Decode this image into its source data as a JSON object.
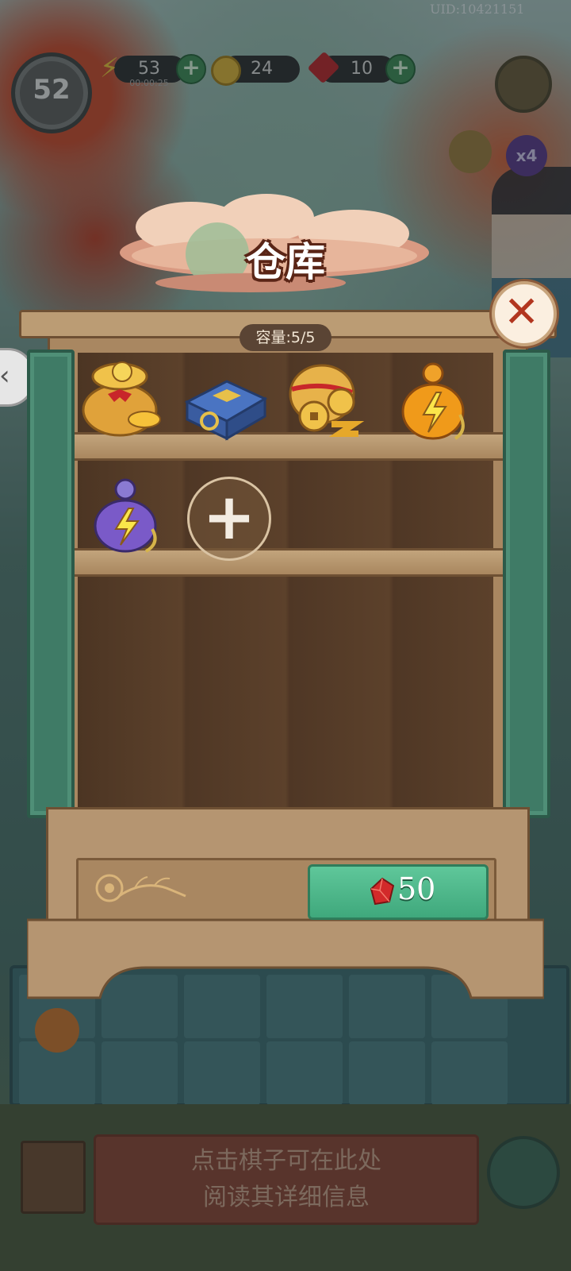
{
  "hud": {
    "uid": "UID:10421151",
    "level": "52",
    "energy": {
      "value": "53",
      "timer": "00:00:25",
      "icon": "lightning-icon"
    },
    "coins": {
      "value": "24",
      "icon": "coin-icon"
    },
    "gems": {
      "value": "10",
      "icon": "red-gem-icon"
    },
    "multiplier": "x4"
  },
  "dialog": {
    "title": "仓库",
    "capacity_label": "容量:5/5",
    "items": [
      {
        "name": "coin-bag",
        "icon": "gold-coin-bag-icon"
      },
      {
        "name": "blue-chest",
        "icon": "blue-treasure-chest-icon"
      },
      {
        "name": "coin-pouch",
        "icon": "coin-pouch-icon"
      },
      {
        "name": "gold-energy-gourd",
        "icon": "gold-lightning-gourd-icon"
      },
      {
        "name": "purple-energy-gourd",
        "icon": "purple-lightning-gourd-icon"
      }
    ],
    "add_slot_symbol": "+",
    "buy_price": "50",
    "close_symbol": "✕"
  },
  "bottom": {
    "tip_line1": "点击棋子可在此处",
    "tip_line2": "阅读其详细信息"
  },
  "colors": {
    "accent_green": "#3fa87c",
    "title_border": "#5a2516",
    "close_red": "#b2361f"
  }
}
